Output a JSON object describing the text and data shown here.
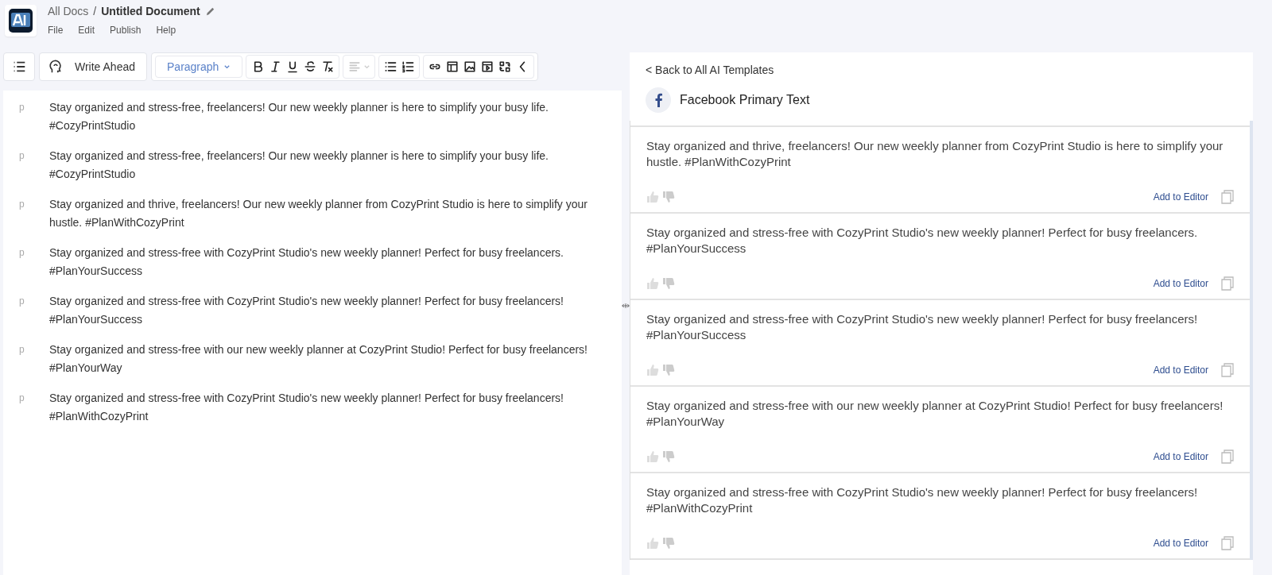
{
  "breadcrumb": {
    "parent": "All Docs",
    "separator": "/",
    "title": "Untitled Document"
  },
  "menu": [
    "File",
    "Edit",
    "Publish",
    "Help"
  ],
  "toolbar": {
    "write_ahead": "Write Ahead",
    "block_type": "Paragraph",
    "groups": [
      [
        {
          "kind": "bold",
          "disabled": false
        },
        {
          "kind": "italic",
          "disabled": false
        },
        {
          "kind": "underline",
          "disabled": false
        },
        {
          "kind": "strike",
          "disabled": false
        },
        {
          "kind": "clear",
          "disabled": false
        }
      ],
      [
        {
          "kind": "align",
          "disabled": true
        }
      ],
      [
        {
          "kind": "bullets",
          "disabled": false
        },
        {
          "kind": "numbers",
          "disabled": false
        }
      ],
      [
        {
          "kind": "link",
          "disabled": false
        },
        {
          "kind": "table",
          "disabled": false
        },
        {
          "kind": "image",
          "disabled": false
        },
        {
          "kind": "video",
          "disabled": false
        },
        {
          "kind": "swap",
          "disabled": false
        },
        {
          "kind": "collapse",
          "disabled": false
        }
      ]
    ]
  },
  "editor": {
    "paragraphs": [
      {
        "tag": "p",
        "text": "Stay organized and stress-free, freelancers! Our new weekly planner is here to simplify your busy life. #CozyPrintStudio"
      },
      {
        "tag": "p",
        "text": "Stay organized and stress-free, freelancers! Our new weekly planner is here to simplify your busy life. #CozyPrintStudio"
      },
      {
        "tag": "p",
        "text": "Stay organized and thrive, freelancers! Our new weekly planner from CozyPrint Studio is here to simplify your hustle. #PlanWithCozyPrint"
      },
      {
        "tag": "p",
        "text": "Stay organized and stress-free with CozyPrint Studio's new weekly planner! Perfect for busy freelancers. #PlanYourSuccess"
      },
      {
        "tag": "p",
        "text": "Stay organized and stress-free with CozyPrint Studio's new weekly planner! Perfect for busy freelancers! #PlanYourSuccess"
      },
      {
        "tag": "p",
        "text": "Stay organized and stress-free with our new weekly planner at CozyPrint Studio! Perfect for busy freelancers! #PlanYourWay"
      },
      {
        "tag": "p",
        "text": "Stay organized and stress-free with CozyPrint Studio's new weekly planner! Perfect for busy freelancers! #PlanWithCozyPrint"
      }
    ]
  },
  "templates": {
    "back_link": "< Back to All AI Templates",
    "title": "Facebook Primary Text",
    "results": [
      {
        "text": "Stay organized and thrive, freelancers! Our new weekly planner from CozyPrint Studio is here to simplify your hustle. #PlanWithCozyPrint",
        "action": "Add to Editor"
      },
      {
        "text": "Stay organized and stress-free with CozyPrint Studio's new weekly planner! Perfect for busy freelancers. #PlanYourSuccess",
        "action": "Add to Editor"
      },
      {
        "text": "Stay organized and stress-free with CozyPrint Studio's new weekly planner! Perfect for busy freelancers! #PlanYourSuccess",
        "action": "Add to Editor"
      },
      {
        "text": "Stay organized and stress-free with our new weekly planner at CozyPrint Studio! Perfect for busy freelancers! #PlanYourWay",
        "action": "Add to Editor"
      },
      {
        "text": "Stay organized and stress-free with CozyPrint Studio's new weekly planner! Perfect for busy freelancers! #PlanWithCozyPrint",
        "action": "Add to Editor"
      }
    ]
  }
}
